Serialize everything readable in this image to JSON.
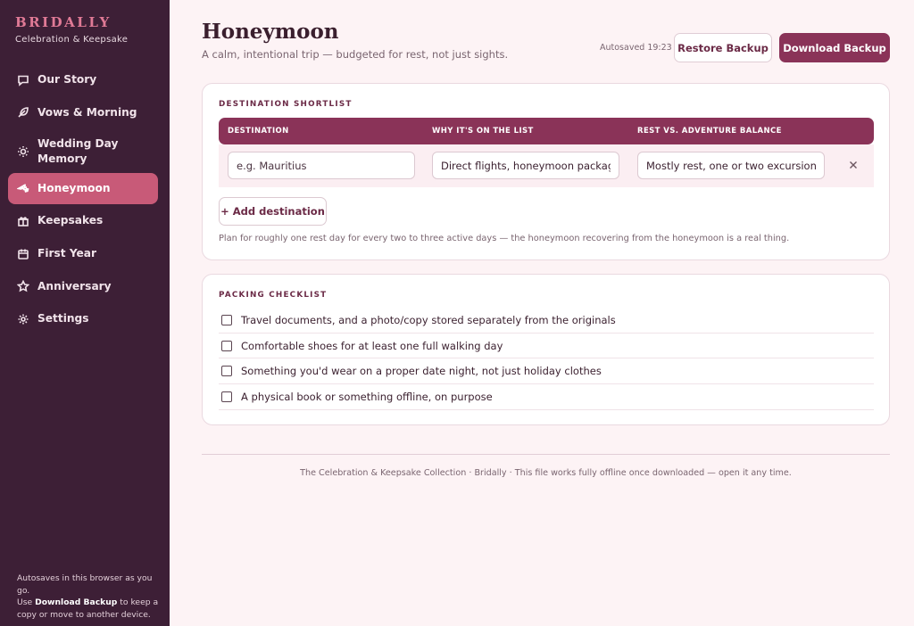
{
  "brand": {
    "name": "BRIDALLY",
    "tagline": "Celebration & Keepsake"
  },
  "sidebar": {
    "items": [
      {
        "label": "Our Story",
        "icon": "chat-bubble-icon"
      },
      {
        "label": "Vows & Morning",
        "icon": "feather-icon"
      },
      {
        "label": "Wedding Day Memory",
        "icon": "sun-icon"
      },
      {
        "label": "Honeymoon",
        "icon": "plane-icon",
        "active": true
      },
      {
        "label": "Keepsakes",
        "icon": "gift-icon"
      },
      {
        "label": "First Year",
        "icon": "calendar-icon"
      },
      {
        "label": "Anniversary",
        "icon": "star-icon"
      },
      {
        "label": "Settings",
        "icon": "gear-icon"
      }
    ],
    "footer": {
      "line1": "Autosaves in this browser as you go.",
      "line2_pre": "Use ",
      "line2_bold": "Download Backup",
      "line2_post": " to keep a copy or move to another device."
    }
  },
  "header": {
    "title": "Honeymoon",
    "subtitle": "A calm, intentional trip — budgeted for rest, not just sights.",
    "autosave": "Autosaved 19:23",
    "restore_label": "Restore Backup",
    "download_label": "Download Backup"
  },
  "shortlist": {
    "title": "DESTINATION SHORTLIST",
    "columns": [
      "DESTINATION",
      "WHY IT'S ON THE LIST",
      "REST VS. ADVENTURE BALANCE"
    ],
    "rows": [
      {
        "destination_placeholder": "e.g. Mauritius",
        "destination": "",
        "why": "Direct flights, honeymoon package",
        "balance": "Mostly rest, one or two excursions"
      }
    ],
    "add_label": "+ Add destination",
    "hint": "Plan for roughly one rest day for every two to three active days — the honeymoon recovering from the honeymoon is a real thing."
  },
  "packing": {
    "title": "PACKING CHECKLIST",
    "items": [
      {
        "label": "Travel documents, and a photo/copy stored separately from the originals",
        "checked": false
      },
      {
        "label": "Comfortable shoes for at least one full walking day",
        "checked": false
      },
      {
        "label": "Something you'd wear on a proper date night, not just holiday clothes",
        "checked": false
      },
      {
        "label": "A physical book or something offline, on purpose",
        "checked": false
      }
    ]
  },
  "footer": "The Celebration & Keepsake Collection · Bridally · This file works fully offline once downloaded — open it any time.",
  "colors": {
    "sidebar_bg": "#3d1f36",
    "accent": "#8a3358",
    "active_nav": "#c85a78",
    "brand": "#e07a96",
    "page_bg": "#fdf3f5"
  }
}
